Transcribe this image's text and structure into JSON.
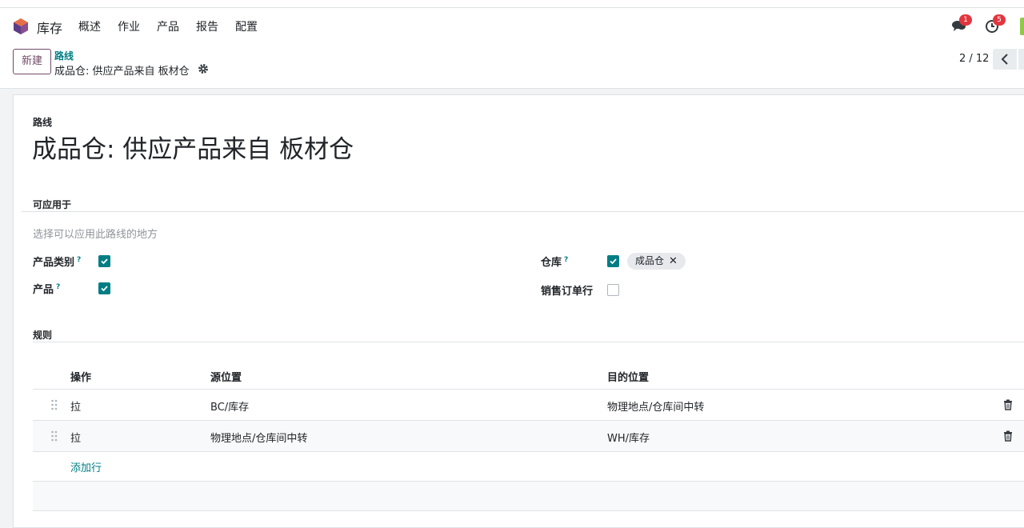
{
  "app": {
    "name": "库存"
  },
  "menu": [
    "概述",
    "作业",
    "产品",
    "报告",
    "配置"
  ],
  "systray": {
    "messages_badge": "1",
    "activity_badge": "5"
  },
  "control": {
    "new_label": "新建",
    "breadcrumb_parent": "路线",
    "breadcrumb_current": "成品仓: 供应产品来自 板材仓",
    "pager": "2 / 12"
  },
  "form": {
    "name_label": "路线",
    "name": "成品仓: 供应产品来自 板材仓",
    "applicable_title": "可应用于",
    "applicable_help": "选择可以应用此路线的地方",
    "product_category_label": "产品类别",
    "product_label": "产品",
    "warehouse_label": "仓库",
    "sale_line_label": "销售订单行",
    "help_mark": "?",
    "product_category_checked": true,
    "product_checked": true,
    "warehouse_checked": true,
    "sale_line_checked": false,
    "warehouse_tag": "成品仓",
    "rules_title": "规则"
  },
  "rules": {
    "columns": [
      "操作",
      "源位置",
      "目的位置"
    ],
    "rows": [
      {
        "action": "拉",
        "source": "BC/库存",
        "dest": "物理地点/仓库间中转"
      },
      {
        "action": "拉",
        "source": "物理地点/仓库间中转",
        "dest": "WH/库存"
      }
    ],
    "add_line": "添加行"
  },
  "colors": {
    "brand": "#714b67",
    "accent": "#017e84",
    "badge": "#e2363f"
  }
}
